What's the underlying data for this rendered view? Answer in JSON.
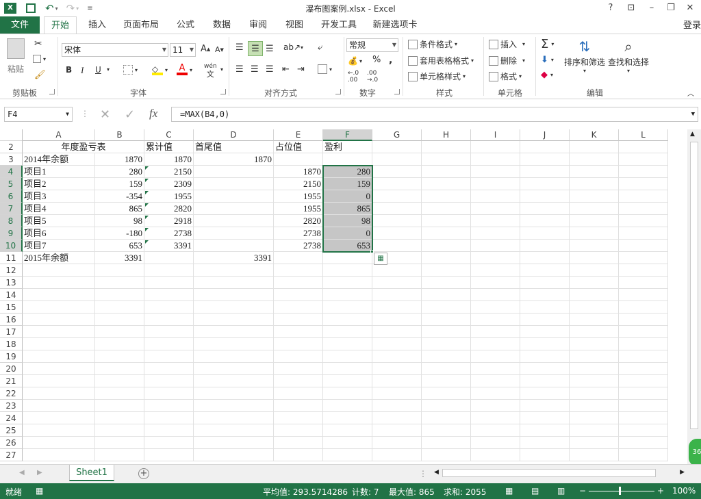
{
  "window": {
    "title": "瀑布图案例.xlsx - Excel",
    "help": "?",
    "login": "登录"
  },
  "tabs": [
    "文件",
    "开始",
    "插入",
    "页面布局",
    "公式",
    "数据",
    "审阅",
    "视图",
    "开发工具",
    "新建选项卡"
  ],
  "ribbon": {
    "clipboard": {
      "paste": "粘贴",
      "label": "剪贴板"
    },
    "font": {
      "name": "宋体",
      "size": "11",
      "bold": "B",
      "italic": "I",
      "underline": "U",
      "label": "字体",
      "grow": "A",
      "shrink": "A",
      "phonetic_top": "wén",
      "phonetic_bottom": "文"
    },
    "align": {
      "label": "对齐方式"
    },
    "number": {
      "format": "常规",
      "label": "数字",
      "percent": "%",
      "comma": ",",
      "inc_dec": "←.0 .00",
      "dec_dec": ".00 →.0"
    },
    "styles": {
      "conditional": "条件格式",
      "table": "套用表格格式",
      "cell": "单元格样式",
      "label": "样式"
    },
    "cells": {
      "insert": "插入",
      "delete": "删除",
      "format": "格式",
      "label": "单元格"
    },
    "editing": {
      "sort": "排序和筛选",
      "find": "查找和选择",
      "label": "编辑",
      "sum": "Σ"
    }
  },
  "formula_bar": {
    "name_box": "F4",
    "cancel": "✕",
    "enter": "✓",
    "fx": "fx",
    "formula": "=MAX(B4,0)"
  },
  "grid": {
    "columns": [
      "A",
      "B",
      "C",
      "D",
      "E",
      "F",
      "G",
      "H",
      "I",
      "J",
      "K",
      "L"
    ],
    "rows": [
      "2",
      "3",
      "4",
      "5",
      "6",
      "7",
      "8",
      "9",
      "10",
      "11",
      "12",
      "13",
      "14",
      "15",
      "16",
      "17",
      "18",
      "19",
      "20",
      "21",
      "22",
      "23",
      "24",
      "25",
      "26",
      "27"
    ],
    "headers": {
      "A": "年度盈亏表",
      "C": "累计值",
      "D": "首尾值",
      "E": "占位值",
      "F": "盈利"
    },
    "data": [
      {
        "A": "2014年余额",
        "B": "1870",
        "C": "1870",
        "D": "1870",
        "E": "",
        "F": ""
      },
      {
        "A": "项目1",
        "B": "280",
        "C": "2150",
        "D": "",
        "E": "1870",
        "F": "280"
      },
      {
        "A": "项目2",
        "B": "159",
        "C": "2309",
        "D": "",
        "E": "2150",
        "F": "159"
      },
      {
        "A": "项目3",
        "B": "-354",
        "C": "1955",
        "D": "",
        "E": "1955",
        "F": "0"
      },
      {
        "A": "项目4",
        "B": "865",
        "C": "2820",
        "D": "",
        "E": "1955",
        "F": "865"
      },
      {
        "A": "项目5",
        "B": "98",
        "C": "2918",
        "D": "",
        "E": "2820",
        "F": "98"
      },
      {
        "A": "项目6",
        "B": "-180",
        "C": "2738",
        "D": "",
        "E": "2738",
        "F": "0"
      },
      {
        "A": "项目7",
        "B": "653",
        "C": "3391",
        "D": "",
        "E": "2738",
        "F": "653"
      },
      {
        "A": "2015年余额",
        "B": "3391",
        "C": "",
        "D": "3391",
        "E": "",
        "F": ""
      }
    ]
  },
  "sheet": {
    "name": "Sheet1",
    "add": "+"
  },
  "status": {
    "mode": "就绪",
    "average": "平均值: 293.5714286",
    "count": "计数: 7",
    "max": "最大值: 865",
    "sum": "求和: 2055",
    "zoom": "100%",
    "badge": "36"
  }
}
